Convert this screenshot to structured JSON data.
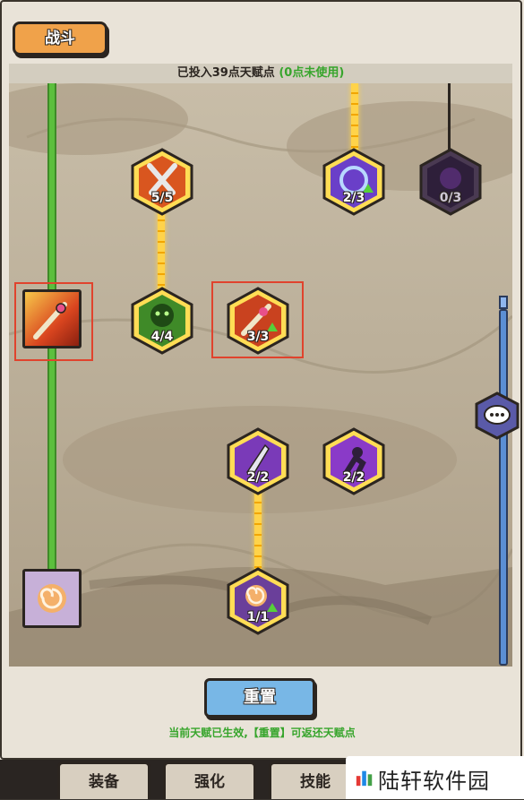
{
  "header": {
    "battle_tab": "战斗"
  },
  "points_bar": {
    "invested": "已投入39点天赋点",
    "unused": "(0点未使用)"
  },
  "talents": {
    "weapon_mastery": {
      "count": "5/5",
      "icon": "crossed-swords-icon"
    },
    "vortex_boost": {
      "count": "2/3",
      "icon": "vortex-icon"
    },
    "shadow_orb": {
      "count": "0/3",
      "icon": "shadow-icon"
    },
    "spirit_guard": {
      "count": "4/4",
      "icon": "green-spirit-icon"
    },
    "sword_upgrade": {
      "count": "3/3",
      "icon": "sword-upgrade-icon"
    },
    "blade_strike": {
      "count": "2/2",
      "icon": "blade-icon"
    },
    "shadow_dash": {
      "count": "2/2",
      "icon": "dash-icon"
    },
    "swirl_upgrade": {
      "count": "1/1",
      "icon": "swirl-icon"
    }
  },
  "side_skills": {
    "fire_sword": {
      "icon": "fire-sword-icon"
    },
    "swirl_skill": {
      "icon": "swirl-skill-icon"
    }
  },
  "actions": {
    "reset_label": "重置",
    "hint": "当前天赋已生效,【重置】可返还天赋点"
  },
  "bottom_tabs": [
    "装备",
    "强化",
    "技能"
  ],
  "watermark": "陆轩软件园",
  "colors": {
    "accent_orange": "#f0a24a",
    "unused_green": "#37a52c",
    "reset_blue": "#78b7e6",
    "highlight_red": "#e0432d"
  }
}
